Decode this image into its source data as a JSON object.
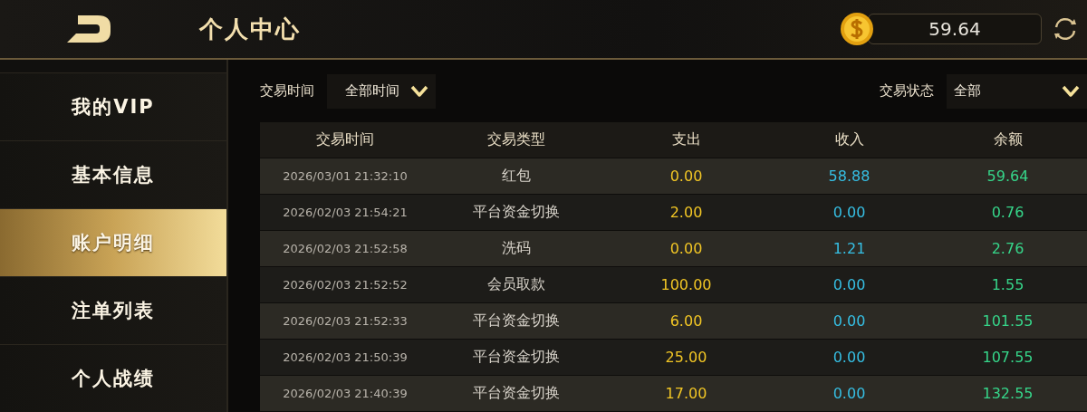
{
  "header": {
    "title": "个人中心",
    "balance": "59.64"
  },
  "sidebar": {
    "items": [
      {
        "label": "我的VIP",
        "selected": false
      },
      {
        "label": "基本信息",
        "selected": false
      },
      {
        "label": "账户明细",
        "selected": true
      },
      {
        "label": "注单列表",
        "selected": false
      },
      {
        "label": "个人战绩",
        "selected": false
      }
    ]
  },
  "filters": [
    {
      "label": "交易时间",
      "value": "全部时间"
    },
    {
      "label": "交易状态",
      "value": "全部"
    }
  ],
  "table": {
    "columns": [
      "交易时间",
      "交易类型",
      "支出",
      "收入",
      "余额"
    ],
    "rows": [
      [
        "2026/03/01 21:32:10",
        "红包",
        "0.00",
        "58.88",
        "59.64"
      ],
      [
        "2026/02/03 21:54:21",
        "平台资金切换",
        "2.00",
        "0.00",
        "0.76"
      ],
      [
        "2026/02/03 21:52:58",
        "洗码",
        "0.00",
        "1.21",
        "2.76"
      ],
      [
        "2026/02/03 21:52:52",
        "会员取款",
        "100.00",
        "0.00",
        "1.55"
      ],
      [
        "2026/02/03 21:52:33",
        "平台资金切换",
        "6.00",
        "0.00",
        "101.55"
      ],
      [
        "2026/02/03 21:50:39",
        "平台资金切换",
        "25.00",
        "0.00",
        "107.55"
      ],
      [
        "2026/02/03 21:40:39",
        "平台资金切换",
        "17.00",
        "0.00",
        "132.55"
      ]
    ]
  }
}
